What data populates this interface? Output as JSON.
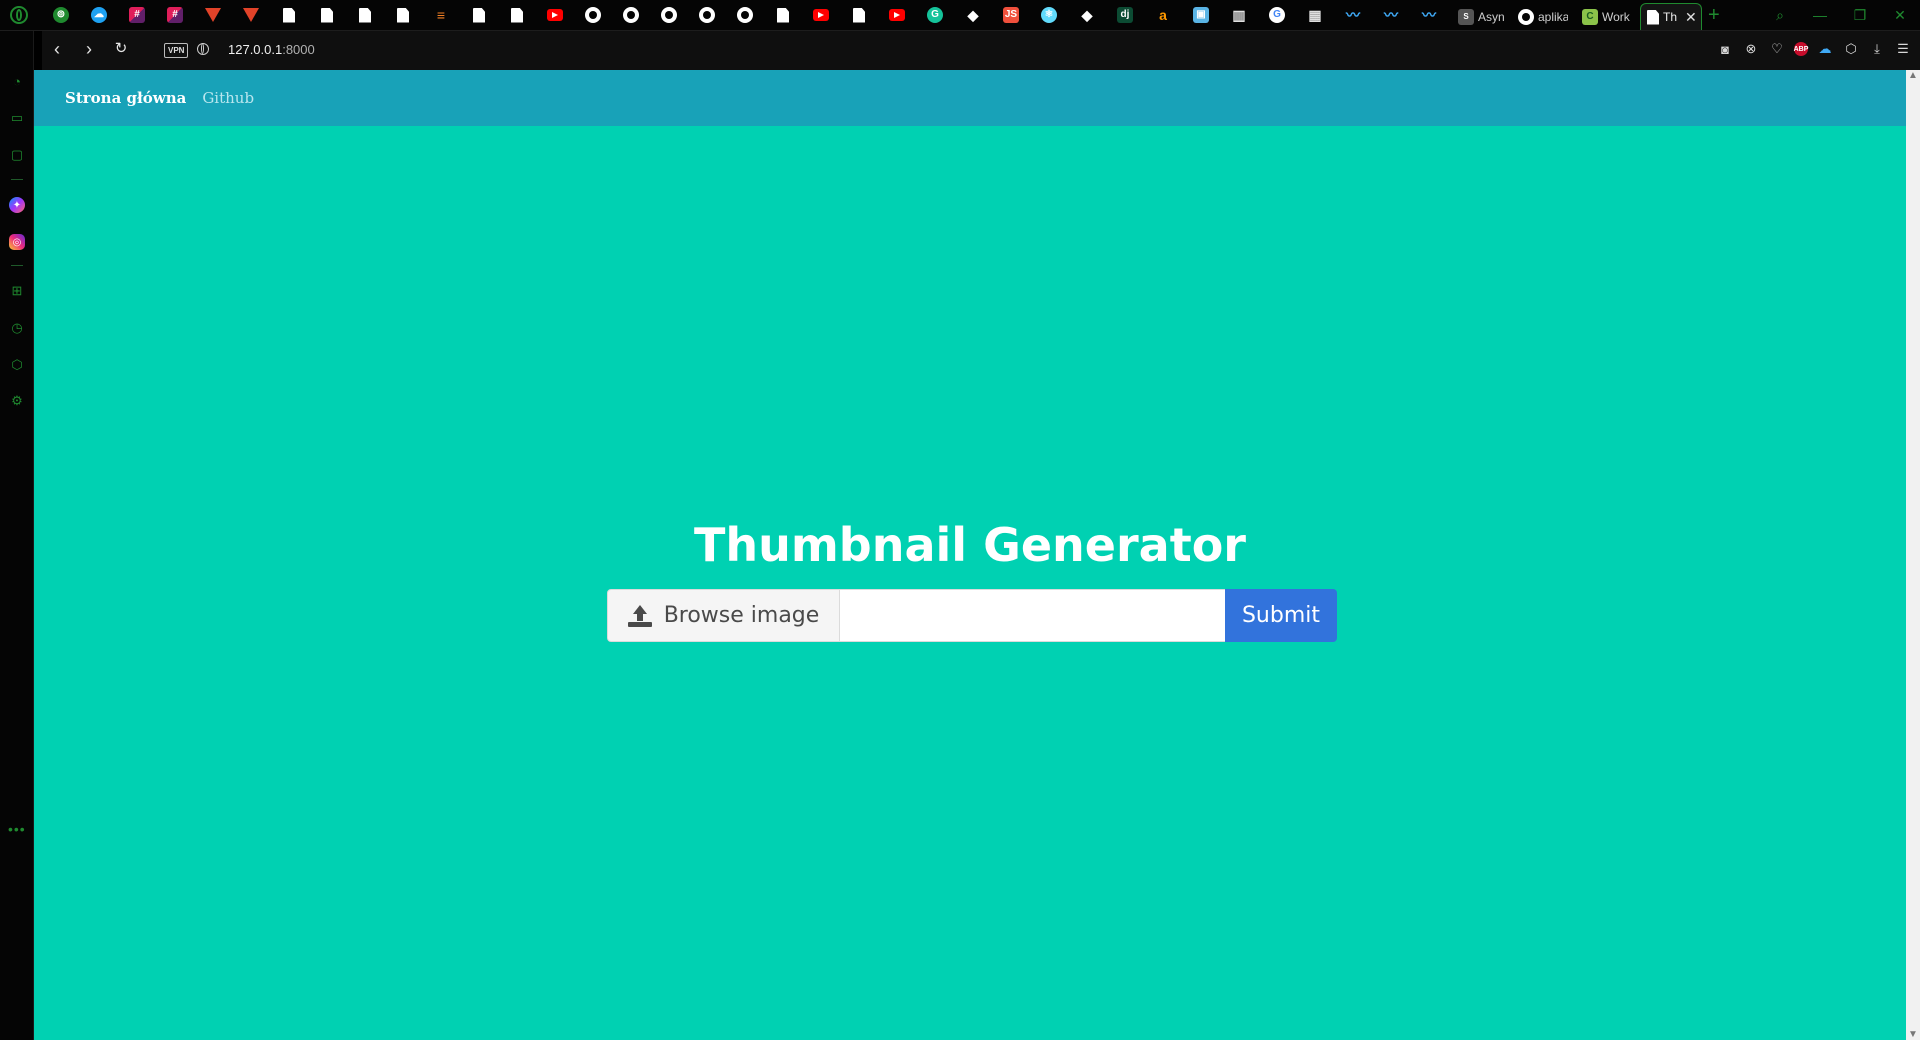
{
  "browser": {
    "pinned_tabs": [
      {
        "icon": "gamepad-icon",
        "style": "round",
        "color": "#1f8a2f",
        "glyph": "⊚"
      },
      {
        "icon": "cloud-icon",
        "style": "round",
        "color": "#1ea1f2",
        "glyph": "☁"
      },
      {
        "icon": "slack-icon",
        "style": "slack",
        "glyph": "#"
      },
      {
        "icon": "slack-icon",
        "style": "slack",
        "glyph": "#"
      },
      {
        "icon": "gitlab-icon",
        "style": "gl",
        "glyph": ""
      },
      {
        "icon": "gitlab-icon",
        "style": "gl",
        "glyph": ""
      },
      {
        "icon": "document-icon",
        "style": "doc",
        "glyph": ""
      },
      {
        "icon": "document-icon",
        "style": "doc",
        "glyph": ""
      },
      {
        "icon": "document-icon",
        "style": "doc",
        "glyph": ""
      },
      {
        "icon": "document-icon",
        "style": "doc",
        "glyph": ""
      },
      {
        "icon": "stackoverflow-icon",
        "style": "plain",
        "color": "#f48024",
        "glyph": "≡"
      },
      {
        "icon": "document-icon",
        "style": "doc",
        "glyph": ""
      },
      {
        "icon": "document-icon",
        "style": "doc",
        "glyph": ""
      },
      {
        "icon": "youtube-icon",
        "style": "yt",
        "glyph": ""
      },
      {
        "icon": "github-icon",
        "style": "gh",
        "glyph": ""
      },
      {
        "icon": "github-icon",
        "style": "gh",
        "glyph": ""
      },
      {
        "icon": "github-icon",
        "style": "gh",
        "glyph": ""
      },
      {
        "icon": "github-icon",
        "style": "gh",
        "glyph": ""
      },
      {
        "icon": "github-icon",
        "style": "gh",
        "glyph": ""
      },
      {
        "icon": "document-icon",
        "style": "doc",
        "glyph": ""
      },
      {
        "icon": "youtube-icon",
        "style": "yt",
        "glyph": ""
      },
      {
        "icon": "document-icon",
        "style": "doc",
        "glyph": ""
      },
      {
        "icon": "youtube-icon",
        "style": "yt",
        "glyph": ""
      },
      {
        "icon": "grammarly-icon",
        "style": "round",
        "color": "#15c39a",
        "glyph": "G"
      },
      {
        "icon": "bird-icon",
        "style": "plain",
        "color": "#ffffff",
        "glyph": "◆"
      },
      {
        "icon": "js-icon",
        "style": "square",
        "color": "#f0503c",
        "glyph": "JS"
      },
      {
        "icon": "react-icon",
        "style": "round",
        "color": "#61dafb",
        "glyph": "⚛"
      },
      {
        "icon": "bird-icon",
        "style": "plain",
        "color": "#ffffff",
        "glyph": "◆"
      },
      {
        "icon": "django-icon",
        "style": "square",
        "color": "#0c4b33",
        "glyph": "dj"
      },
      {
        "icon": "amazon-icon",
        "style": "plain",
        "color": "#ff9900",
        "glyph": "a"
      },
      {
        "icon": "cube-icon",
        "style": "square",
        "color": "#5ab4e5",
        "glyph": "▣"
      },
      {
        "icon": "book-icon",
        "style": "plain",
        "color": "#e0e0e0",
        "glyph": "▥"
      },
      {
        "icon": "google-icon",
        "style": "round",
        "color": "#ffffff",
        "glyph": "G",
        "text": "#4285f4"
      },
      {
        "icon": "chart-icon",
        "style": "plain",
        "color": "#e0e0e0",
        "glyph": "▦"
      },
      {
        "icon": "wave-icon",
        "style": "plain",
        "color": "#3fa9f5",
        "glyph": "〰"
      },
      {
        "icon": "wave-icon",
        "style": "plain",
        "color": "#3fa9f5",
        "glyph": "〰"
      },
      {
        "icon": "wave-icon",
        "style": "plain",
        "color": "#3fa9f5",
        "glyph": "〰"
      }
    ],
    "named_tabs": [
      {
        "label": "Async",
        "icon": "tab-favicon-icon",
        "color": "#555555",
        "glyph": "S"
      },
      {
        "label": "aplika",
        "icon": "github-icon",
        "color": "#ffffff",
        "glyph": ""
      },
      {
        "label": "Work",
        "icon": "tab-favicon-icon",
        "color": "#8bc34a",
        "glyph": "C"
      },
      {
        "label": "Th",
        "icon": "document-icon",
        "color": "#ffffff",
        "glyph": "",
        "active": true
      }
    ],
    "new_tab_label": "+",
    "window_controls": [
      "⌕",
      "—",
      "❐",
      "✕"
    ],
    "url_host": "127.0.0.1",
    "url_port": ":8000",
    "vpn_label": "VPN",
    "addr_icons": [
      {
        "name": "snapshot-icon",
        "glyph": "◙"
      },
      {
        "name": "close-circle-icon",
        "glyph": "⊗"
      },
      {
        "name": "heart-icon",
        "glyph": "♡"
      },
      {
        "name": "adblock-plus-icon",
        "glyph": "ABP"
      },
      {
        "name": "cloud-icon",
        "glyph": "☁"
      },
      {
        "name": "box-icon",
        "glyph": "⬡"
      },
      {
        "name": "download-icon",
        "glyph": "⤓"
      },
      {
        "name": "menu-icon",
        "glyph": "☰"
      }
    ],
    "sidebar_icons": [
      {
        "name": "speed-dial-icon",
        "glyph": "◔"
      },
      {
        "name": "briefcase-icon",
        "glyph": "▭"
      },
      {
        "name": "twitch-icon",
        "glyph": "▢"
      },
      {
        "name": "messenger-icon",
        "glyph": "✦"
      },
      {
        "name": "instagram-icon",
        "glyph": "◎"
      },
      {
        "name": "grid-icon",
        "glyph": "⊞"
      },
      {
        "name": "history-icon",
        "glyph": "◷"
      },
      {
        "name": "cube-icon",
        "glyph": "⬡"
      },
      {
        "name": "settings-icon",
        "glyph": "⚙"
      }
    ],
    "sidebar_more": "•••"
  },
  "site": {
    "nav_home": "Strona główna",
    "nav_github": "Github",
    "title": "Thumbnail Generator",
    "browse_label": "Browse image",
    "file_name": "",
    "submit_label": "Submit",
    "background": "#00d1b2",
    "navbar_color": "#18a2b8",
    "button_color": "#3273dc"
  }
}
